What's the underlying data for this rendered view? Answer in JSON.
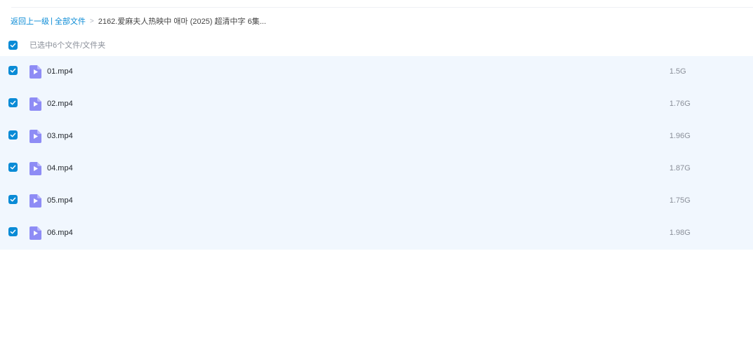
{
  "breadcrumb": {
    "back_label": "返回上一级",
    "pipe": "|",
    "all_files_label": "全部文件",
    "separator": ">",
    "current_folder": "2162.爱麻夫人热映中 애마 (2025) 超清中字 6集..."
  },
  "selection": {
    "summary_text": "已选中6个文件/文件夹",
    "all_selected": true
  },
  "files": [
    {
      "name": "01.mp4",
      "size": "1.5G",
      "selected": true,
      "icon": "video-file-icon"
    },
    {
      "name": "02.mp4",
      "size": "1.76G",
      "selected": true,
      "icon": "video-file-icon"
    },
    {
      "name": "03.mp4",
      "size": "1.96G",
      "selected": true,
      "icon": "video-file-icon"
    },
    {
      "name": "04.mp4",
      "size": "1.87G",
      "selected": true,
      "icon": "video-file-icon"
    },
    {
      "name": "05.mp4",
      "size": "1.75G",
      "selected": true,
      "icon": "video-file-icon"
    },
    {
      "name": "06.mp4",
      "size": "1.98G",
      "selected": true,
      "icon": "video-file-icon"
    }
  ],
  "colors": {
    "accent": "#0a8bd6",
    "row_background": "#f1f7fe",
    "file_icon": "#8e8cf5"
  }
}
